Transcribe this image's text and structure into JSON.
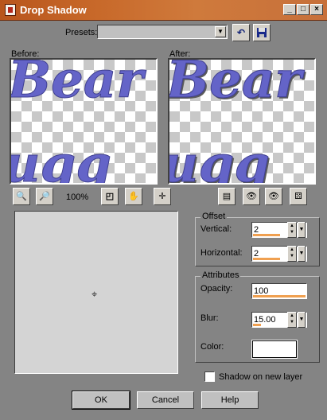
{
  "window": {
    "title": "Drop Shadow"
  },
  "titlebar_buttons": [
    "_",
    "□",
    "×"
  ],
  "presets": {
    "label": "Presets:",
    "value": ""
  },
  "preview": {
    "before_label": "Before:",
    "after_label": "After:",
    "text_line1": "Bear",
    "text_line2": "ugg"
  },
  "zoom": {
    "value": "100%"
  },
  "offset": {
    "title": "Offset",
    "vertical_label": "Vertical:",
    "vertical_value": "2",
    "horizontal_label": "Horizontal:",
    "horizontal_value": "2"
  },
  "attributes": {
    "title": "Attributes",
    "opacity_label": "Opacity:",
    "opacity_value": "100",
    "blur_label": "Blur:",
    "blur_value": "15.00",
    "color_label": "Color:",
    "color_value": "#ffffff"
  },
  "shadow_on_new_layer": {
    "label": "Shadow on new layer",
    "checked": false
  },
  "buttons": {
    "ok": "OK",
    "cancel": "Cancel",
    "help": "Help"
  },
  "colors": {
    "titlebar": "#c8692a",
    "dialog_bg": "#848484",
    "text_fill": "#6464c8",
    "slider_fill": "#f0a050"
  }
}
